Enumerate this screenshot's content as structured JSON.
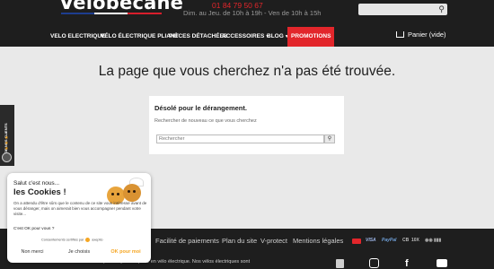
{
  "header": {
    "logo": "Velobecane",
    "phone": "01 84 79 50 67",
    "hours": "Dim. au Jeu. de 10h à 19h - Ven de 10h à 15h",
    "search_icon": "search-icon"
  },
  "nav": {
    "items": [
      {
        "label": "VELO ELECTRIQUE"
      },
      {
        "label": "VÉLO ÉLECTRIQUE PLIANT"
      },
      {
        "label": "PIÈCES DÉTACHÉES"
      },
      {
        "label": "ACCESSOIRES"
      },
      {
        "label": "BLOG"
      },
      {
        "label": "PROMOTIONS"
      }
    ],
    "cart_label": "Panier",
    "cart_state": "(vide)"
  },
  "main": {
    "title": "La page que vous cherchez n'a pas été trouvée.",
    "panel_heading": "Désolé pour le dérangement.",
    "panel_text": "Rechercher de nouveau ce que vous cherchez",
    "search_placeholder": "Rechercher"
  },
  "reviews_tab": {
    "label": "AVIS DE NOS CLIENTS"
  },
  "cookie_popup": {
    "greeting": "Salut c'est nous...",
    "title": "les Cookies !",
    "body": "On a attendu d'être sûrs que le contenu de ce site vous intéresse avant de vous déranger, mais on aimerait bien vous accompagner pendant votre visite...",
    "question": "C'est OK pour vous ?",
    "certified": "Consentements certifiés par",
    "certifier": "axeptio",
    "btn_refuse": "Non merci",
    "btn_choose": "Je choisis",
    "btn_accept": "OK pour moi"
  },
  "footer": {
    "links": [
      "Facilité de paiements",
      "Plan du site",
      "V-protect",
      "Mentions légales"
    ],
    "payments": [
      "VISA",
      "PayPal",
      "CB",
      "10X"
    ],
    "legal_line": "Velobecane est une marque française experte en vélo électrique. Nos vélos électriques sont",
    "social_icons": [
      "newspaper-icon",
      "instagram-icon",
      "facebook-icon",
      "youtube-icon"
    ]
  },
  "colors": {
    "header_bg": "#1e1e1e",
    "accent_red": "#e2262b",
    "page_bg": "#e9e9e9",
    "cookie_accent": "#f5a623"
  }
}
